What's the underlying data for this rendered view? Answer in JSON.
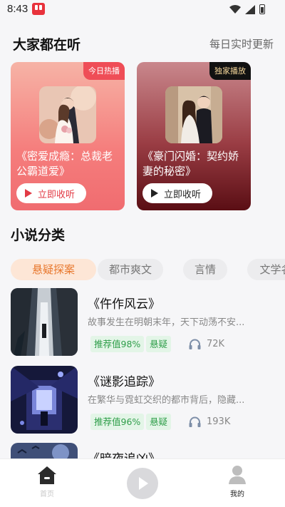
{
  "status_bar": {
    "time": "8:43"
  },
  "hot_section": {
    "title": "大家都在听",
    "link": "每日实时更新"
  },
  "featured": [
    {
      "badge": "今日热播",
      "title": "《密爱成瘾：总裁老公霸道爱》",
      "button": "立即收听"
    },
    {
      "badge": "独家播放",
      "title": "《豪门闪婚：契约娇妻的秘密》",
      "button": "立即收听"
    }
  ],
  "category_section": {
    "title": "小说分类"
  },
  "categories": [
    "悬疑探案",
    "都市爽文",
    "言情",
    "文学名"
  ],
  "books": [
    {
      "title": "《仵作风云》",
      "desc": "故事发生在明朝末年，天下动荡不安...",
      "tag_score": "推荐值98%",
      "tag_genre": "悬疑",
      "listens": "72K"
    },
    {
      "title": "《谜影追踪》",
      "desc": "在繁华与霓虹交织的都市背后，隐藏...",
      "tag_score": "推荐值96%",
      "tag_genre": "悬疑",
      "listens": "193K"
    },
    {
      "title": "《暗夜追凶》"
    }
  ],
  "nav": {
    "home": "首页",
    "mine": "我的"
  }
}
